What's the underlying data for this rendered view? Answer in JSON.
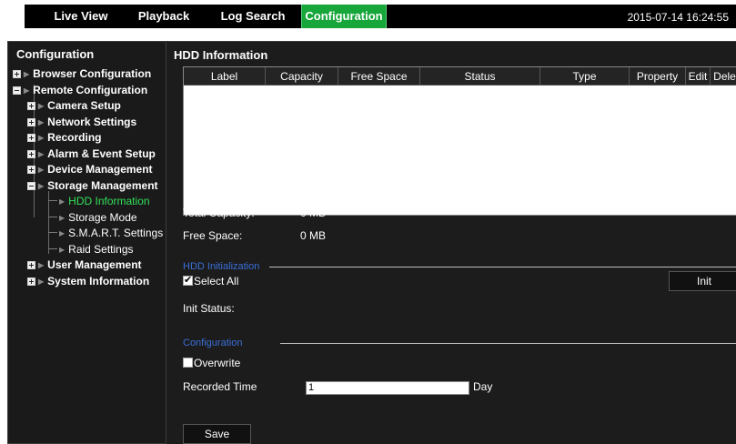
{
  "tabs": [
    {
      "label": "Live View"
    },
    {
      "label": "Playback"
    },
    {
      "label": "Log Search"
    },
    {
      "label": "Configuration"
    }
  ],
  "active_tab": "Configuration",
  "datetime": "2015-07-14 16:24:55",
  "sidebar": {
    "title": "Configuration",
    "items": [
      {
        "label": "Browser Configuration"
      },
      {
        "label": "Remote Configuration"
      },
      {
        "label": "Camera Setup"
      },
      {
        "label": "Network Settings"
      },
      {
        "label": "Recording"
      },
      {
        "label": "Alarm & Event Setup"
      },
      {
        "label": "Device Management"
      },
      {
        "label": "Storage Management"
      },
      {
        "label": "HDD Information"
      },
      {
        "label": "Storage Mode"
      },
      {
        "label": "S.M.A.R.T. Settings"
      },
      {
        "label": "Raid Settings"
      },
      {
        "label": "User Management"
      },
      {
        "label": "System Information"
      }
    ]
  },
  "content": {
    "title": "HDD Information",
    "table_columns": [
      "Label",
      "Capacity",
      "Free Space",
      "Status",
      "Type",
      "Property",
      "Edit",
      "Delete"
    ],
    "total_capacity_label": "Total Capacity:",
    "total_capacity_value": "0 MB",
    "free_space_label": "Free Space:",
    "free_space_value": "0 MB",
    "hdd_init_title": "HDD Initialization",
    "select_all_label": "Select All",
    "select_all_checked": true,
    "init_button": "Init",
    "init_status_label": "Init Status:",
    "config_title": "Configuration",
    "overwrite_label": "Overwrite",
    "overwrite_checked": false,
    "recorded_time_label": "Recorded Time",
    "recorded_time_value": "1",
    "recorded_time_unit": "Day",
    "save_button": "Save"
  },
  "colors": {
    "active_tab": "#16a63a",
    "active_tree_item": "#33e05a",
    "section_title": "#3a6fd8",
    "background": "#1c1c1c"
  }
}
